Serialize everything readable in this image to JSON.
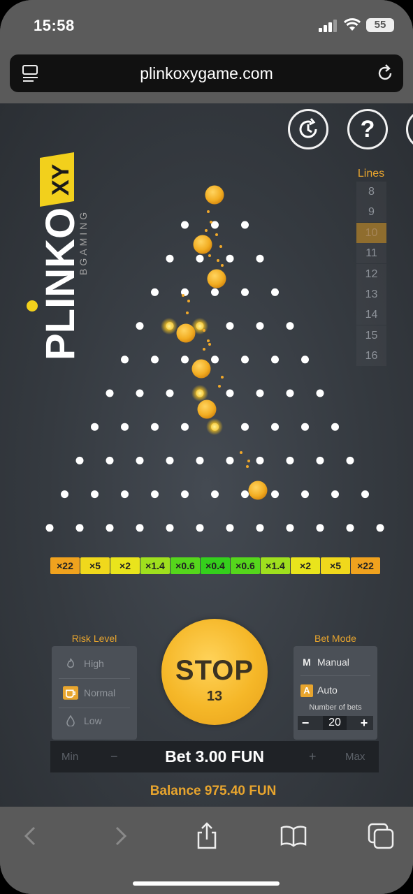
{
  "status_bar": {
    "time": "15:58",
    "battery": "55"
  },
  "browser": {
    "url": "plinkoxygame.com"
  },
  "game": {
    "logo": {
      "text": "PLINKO",
      "xy": "XY",
      "brand": "BGAMING"
    },
    "help_label": "?",
    "lines": {
      "title": "Lines",
      "options": [
        "8",
        "9",
        "10",
        "11",
        "12",
        "13",
        "14",
        "15",
        "16"
      ],
      "selected": "10"
    },
    "multipliers": [
      {
        "label": "×22",
        "color": "#f0a21e"
      },
      {
        "label": "×5",
        "color": "#f0d81c"
      },
      {
        "label": "×2",
        "color": "#e9e41c"
      },
      {
        "label": "×1.4",
        "color": "#9fe01e"
      },
      {
        "label": "×0.6",
        "color": "#55d61c"
      },
      {
        "label": "×0.4",
        "color": "#34cf1c"
      },
      {
        "label": "×0.6",
        "color": "#55d61c"
      },
      {
        "label": "×1.4",
        "color": "#9fe01e"
      },
      {
        "label": "×2",
        "color": "#e9e41c"
      },
      {
        "label": "×5",
        "color": "#f0d81c"
      },
      {
        "label": "×22",
        "color": "#f0a21e"
      }
    ],
    "risk": {
      "title": "Risk Level",
      "options": [
        {
          "label": "High",
          "icon": "flame-icon"
        },
        {
          "label": "Normal",
          "icon": "coffee-icon"
        },
        {
          "label": "Low",
          "icon": "drop-icon"
        }
      ],
      "selected": "Normal"
    },
    "stop_button": {
      "label": "STOP",
      "count": "13"
    },
    "bet_mode": {
      "title": "Bet Mode",
      "manual_key": "M",
      "manual_label": "Manual",
      "auto_key": "A",
      "auto_label": "Auto",
      "selected": "Auto",
      "number_of_bets_label": "Number of bets",
      "number_of_bets": "20",
      "minus": "−",
      "plus": "+"
    },
    "bet": {
      "min": "Min",
      "minus": "−",
      "text": "Bet 3.00 FUN",
      "plus": "+",
      "max": "Max"
    },
    "balance": "Balance 975.40 FUN"
  },
  "colors": {
    "accent": "#e8a52e",
    "ball": "#f5b728",
    "peg": "#ffffff"
  }
}
